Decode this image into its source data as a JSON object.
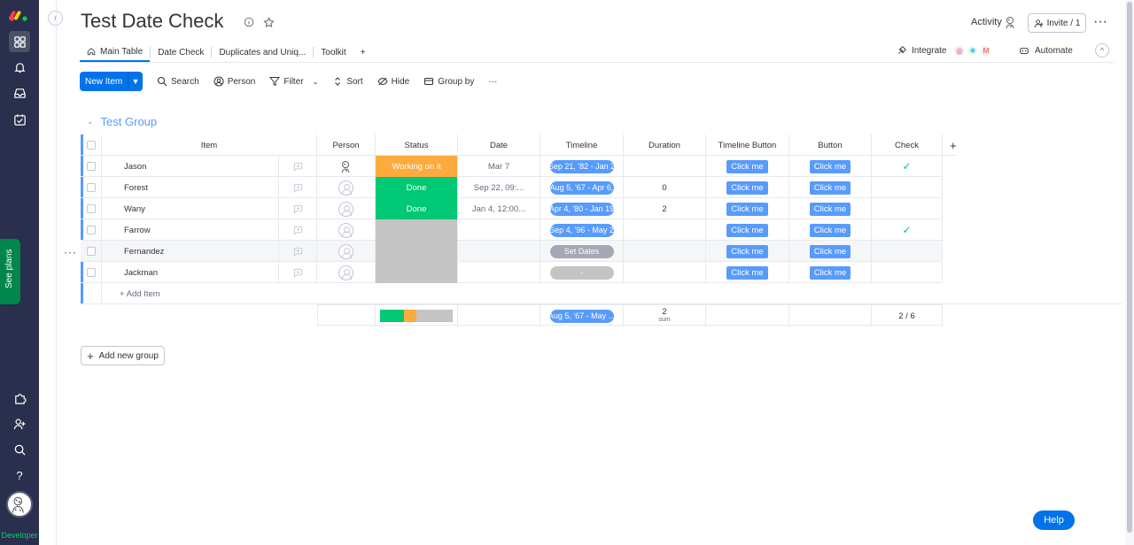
{
  "app": {
    "developer_label": "Developer",
    "see_plans_label": "See plans",
    "help_label": "Help"
  },
  "board": {
    "title": "Test Date Check",
    "activity_label": "Activity",
    "invite_label": "Invite / 1"
  },
  "tabs": [
    {
      "label": "Main Table",
      "active": true
    },
    {
      "label": "Date Check",
      "active": false
    },
    {
      "label": "Duplicates and Uniq...",
      "active": false
    },
    {
      "label": "Toolkit",
      "active": false
    },
    {
      "label": "+",
      "active": false
    }
  ],
  "top_actions": {
    "integrate_label": "Integrate",
    "automate_label": "Automate"
  },
  "toolbar": {
    "new_item_label": "New Item",
    "search_label": "Search",
    "person_label": "Person",
    "filter_label": "Filter",
    "sort_label": "Sort",
    "hide_label": "Hide",
    "group_by_label": "Group by",
    "more_label": "···"
  },
  "group": {
    "title": "Test Group",
    "color": "#579bfc",
    "add_item_label": "+ Add Item",
    "add_new_group_label": "Add new group"
  },
  "columns": [
    "Item",
    "Person",
    "Status",
    "Date",
    "Timeline",
    "Duration",
    "Timeline Button",
    "Button",
    "Check",
    "+"
  ],
  "rows": [
    {
      "item": "Jason",
      "person": "avatar",
      "status": "Working on it",
      "status_color": "#fdab3d",
      "date": "Mar 7",
      "timeline": "Sep 21, '82 - Jan 2",
      "timeline_color": "#579bfc",
      "duration": "",
      "timeline_button": "Click me",
      "button": "Click me",
      "check": true
    },
    {
      "item": "Forest",
      "person": "empty",
      "status": "Done",
      "status_color": "#00c875",
      "date": "Sep 22, 09:...",
      "timeline": "Aug 5, '67 - Apr 6,",
      "timeline_color": "#579bfc",
      "duration": "0",
      "timeline_button": "Click me",
      "button": "Click me",
      "check": false
    },
    {
      "item": "Wany",
      "person": "empty",
      "status": "Done",
      "status_color": "#00c875",
      "date": "Jan 4, 12:00...",
      "timeline": "Apr 4, '80 - Jan 19",
      "timeline_color": "#579bfc",
      "duration": "2",
      "timeline_button": "Click me",
      "button": "Click me",
      "check": false
    },
    {
      "item": "Farrow",
      "person": "empty",
      "status": "",
      "status_color": "#c4c4c4",
      "date": "",
      "timeline": "Sep 4, '96 - May 2",
      "timeline_color": "#579bfc",
      "duration": "",
      "timeline_button": "Click me",
      "button": "Click me",
      "check": true
    },
    {
      "item": "Fernandez",
      "person": "empty",
      "status": "",
      "status_color": "#c4c4c4",
      "date": "",
      "timeline": "Set Dates",
      "timeline_color": "#a5a8b5",
      "duration": "",
      "timeline_button": "Click me",
      "button": "Click me",
      "check": false
    },
    {
      "item": "Jackman",
      "person": "empty",
      "status": "",
      "status_color": "#c4c4c4",
      "date": "",
      "timeline": "-",
      "timeline_color": "#c4c4c4",
      "duration": "",
      "timeline_button": "Click me",
      "button": "Click me",
      "check": false
    }
  ],
  "summary": {
    "status_distribution": [
      {
        "label": "Done",
        "fraction": 0.333,
        "color": "#00c875"
      },
      {
        "label": "Working on it",
        "fraction": 0.167,
        "color": "#fdab3d"
      },
      {
        "label": "Empty",
        "fraction": 0.5,
        "color": "#c4c4c4"
      }
    ],
    "timeline": "Aug 5, '67 - May ...",
    "duration_value": "2",
    "duration_caption": "sum",
    "check": "2 / 6"
  }
}
